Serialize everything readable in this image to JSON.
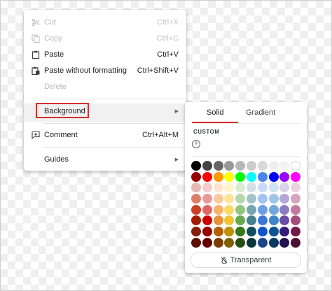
{
  "context_menu": {
    "cut": {
      "label": "Cut",
      "shortcut": "Ctrl+X",
      "icon": "scissors-icon",
      "disabled": true
    },
    "copy": {
      "label": "Copy",
      "shortcut": "Ctrl+C",
      "icon": "copy-icon",
      "disabled": true
    },
    "paste": {
      "label": "Paste",
      "shortcut": "Ctrl+V",
      "icon": "clipboard-icon"
    },
    "paste_plain": {
      "label": "Paste without formatting",
      "shortcut": "Ctrl+Shift+V",
      "icon": "clipboard-text-icon"
    },
    "delete": {
      "label": "Delete",
      "disabled": true
    },
    "background": {
      "label": "Background",
      "has_submenu": true
    },
    "comment": {
      "label": "Comment",
      "shortcut": "Ctrl+Alt+M",
      "icon": "comment-add-icon"
    },
    "guides": {
      "label": "Guides",
      "has_submenu": true
    }
  },
  "highlight_color": "#d32f2f",
  "color_panel": {
    "tabs": [
      {
        "label": "Solid",
        "active": true
      },
      {
        "label": "Gradient",
        "active": false
      }
    ],
    "custom_label": "CUSTOM",
    "transparent_label": "Transparent",
    "swatch_rows": [
      [
        "#000000",
        "#434343",
        "#666666",
        "#999999",
        "#b7b7b7",
        "#cccccc",
        "#d9d9d9",
        "#efefef",
        "#f3f3f3",
        "#ffffff"
      ],
      [
        "#980000",
        "#ff0000",
        "#ff9900",
        "#ffff00",
        "#00ff00",
        "#00ffff",
        "#4a86e8",
        "#0000ff",
        "#9900ff",
        "#ff00ff"
      ],
      [
        "#e6b8af",
        "#f4cccc",
        "#fce5cd",
        "#fff2cc",
        "#d9ead3",
        "#d0e0e3",
        "#c9daf8",
        "#cfe2f3",
        "#d9d2e9",
        "#ead1dc"
      ],
      [
        "#dd7e6b",
        "#ea9999",
        "#f9cb9c",
        "#ffe599",
        "#b6d7a8",
        "#a2c4c9",
        "#a4c2f4",
        "#9fc5e8",
        "#b4a7d6",
        "#d5a6bd"
      ],
      [
        "#cc4125",
        "#e06666",
        "#f6b26b",
        "#ffd966",
        "#93c47d",
        "#76a5af",
        "#6d9eeb",
        "#6fa8dc",
        "#8e7cc3",
        "#c27ba0"
      ],
      [
        "#a61c00",
        "#cc0000",
        "#e69138",
        "#f1c232",
        "#6aa84f",
        "#45818e",
        "#3c78d8",
        "#3d85c6",
        "#674ea7",
        "#a64d79"
      ],
      [
        "#85200c",
        "#990000",
        "#b45f06",
        "#bf9000",
        "#38761d",
        "#134f5c",
        "#1155cc",
        "#0b5394",
        "#351c75",
        "#741b47"
      ],
      [
        "#5b0f00",
        "#660000",
        "#783f04",
        "#7f6000",
        "#274e13",
        "#0c343d",
        "#1c4587",
        "#073763",
        "#20124d",
        "#4c1130"
      ]
    ]
  }
}
